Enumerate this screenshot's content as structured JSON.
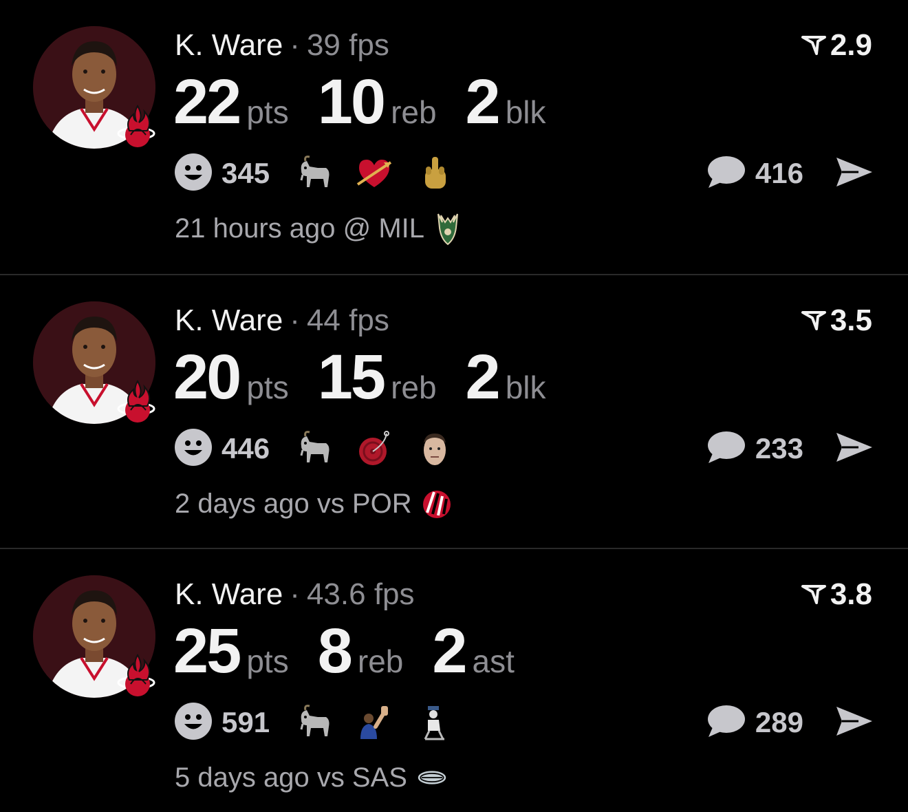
{
  "feed": [
    {
      "player": "K. Ware",
      "separator": "·",
      "fps": "39 fps",
      "rating": "2.9",
      "stats": [
        {
          "value": "22",
          "unit": "pts"
        },
        {
          "value": "10",
          "unit": "reb"
        },
        {
          "value": "2",
          "unit": "blk"
        }
      ],
      "reaction_count": "345",
      "reaction_emojis": [
        "goat-icon",
        "heart-arrow-icon",
        "middle-finger-icon"
      ],
      "comment_count": "416",
      "game_time": "21 hours ago @ MIL",
      "opponent_logo": "bucks-logo-icon"
    },
    {
      "player": "K. Ware",
      "separator": "·",
      "fps": "44 fps",
      "rating": "3.5",
      "stats": [
        {
          "value": "20",
          "unit": "pts"
        },
        {
          "value": "15",
          "unit": "reb"
        },
        {
          "value": "2",
          "unit": "blk"
        }
      ],
      "reaction_count": "446",
      "reaction_emojis": [
        "goat-icon",
        "yoyo-icon",
        "face-avatar-icon"
      ],
      "comment_count": "233",
      "game_time": "2 days ago vs POR",
      "opponent_logo": "blazers-logo-icon"
    },
    {
      "player": "K. Ware",
      "separator": "·",
      "fps": "43.6 fps",
      "rating": "3.8",
      "stats": [
        {
          "value": "25",
          "unit": "pts"
        },
        {
          "value": "8",
          "unit": "reb"
        },
        {
          "value": "2",
          "unit": "ast"
        }
      ],
      "reaction_count": "591",
      "reaction_emojis": [
        "goat-icon",
        "wave-figure-icon",
        "chair-figure-icon"
      ],
      "comment_count": "289",
      "game_time": "5 days ago vs SAS",
      "opponent_logo": "spurs-logo-icon"
    }
  ],
  "colors": {
    "background": "#000000",
    "text_primary": "#f2f2f2",
    "text_secondary": "#8e8e93",
    "divider": "#2a2a2a",
    "avatar_bg": "#3a1016",
    "heat_red": "#c8102e"
  }
}
